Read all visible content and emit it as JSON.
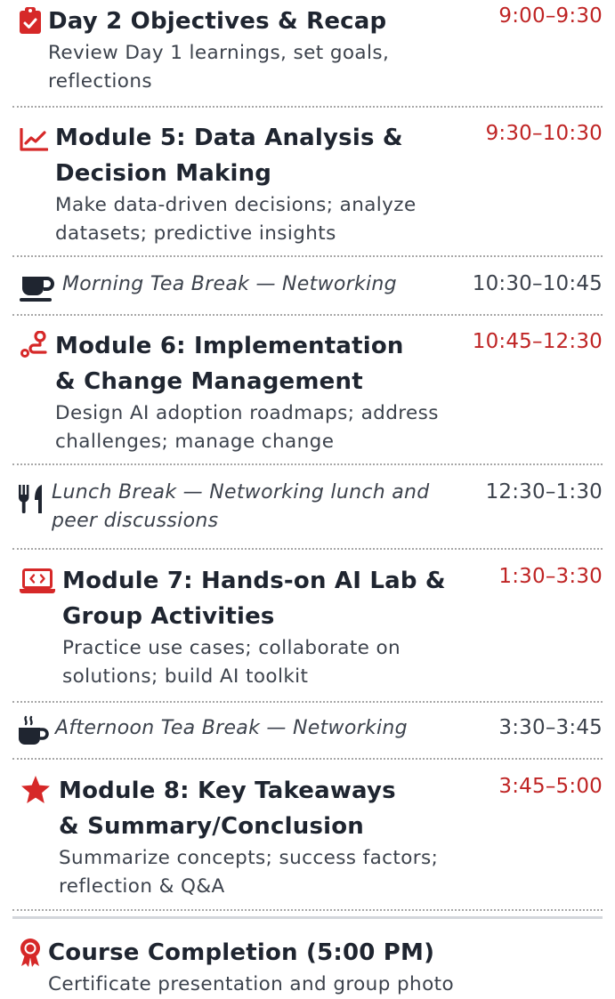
{
  "colors": {
    "accent": "#d62828",
    "time_text": "#bf2424",
    "text": "#1f2530",
    "muted": "#3c424c",
    "divider": "#a7a7a7"
  },
  "agenda": [
    {
      "icon": "clipboard-check-icon",
      "title": "Day 2 Objectives & Recap",
      "description": "Review Day 1 learnings, set goals, reflections",
      "time": "9:00–9:30"
    },
    {
      "icon": "line-chart-icon",
      "title": "Module 5: Data Analysis & Decision Making",
      "description": "Make data-driven decisions; analyze datasets; predictive insights",
      "time": "9:30–10:30"
    },
    {
      "icon": "tea-mug-icon",
      "label": "Morning Tea Break — Networking",
      "time": "10:30–10:45"
    },
    {
      "icon": "route-icon",
      "title": "Module 6: Implementation & Change Management",
      "description": "Design AI adoption roadmaps; address challenges; manage change",
      "time": "10:45–12:30"
    },
    {
      "icon": "utensils-icon",
      "label": "Lunch Break — Networking lunch and peer discussions",
      "time": "12:30–1:30"
    },
    {
      "icon": "laptop-code-icon",
      "title": "Module 7: Hands-on AI Lab & Group Activities",
      "description": "Practice use cases; collaborate on solutions; build AI toolkit",
      "time": "1:30–3:30"
    },
    {
      "icon": "hot-mug-icon",
      "label": "Afternoon Tea Break — Networking",
      "time": "3:30–3:45"
    },
    {
      "icon": "star-icon",
      "title": "Module 8: Key Takeaways & Summary/Conclusion",
      "description": "Summarize concepts; success factors; reflection & Q&A",
      "time": "3:45–5:00"
    }
  ],
  "completion": {
    "icon": "award-ribbon-icon",
    "title": "Course Completion (5:00 PM)",
    "description": "Certificate presentation and group photo"
  }
}
